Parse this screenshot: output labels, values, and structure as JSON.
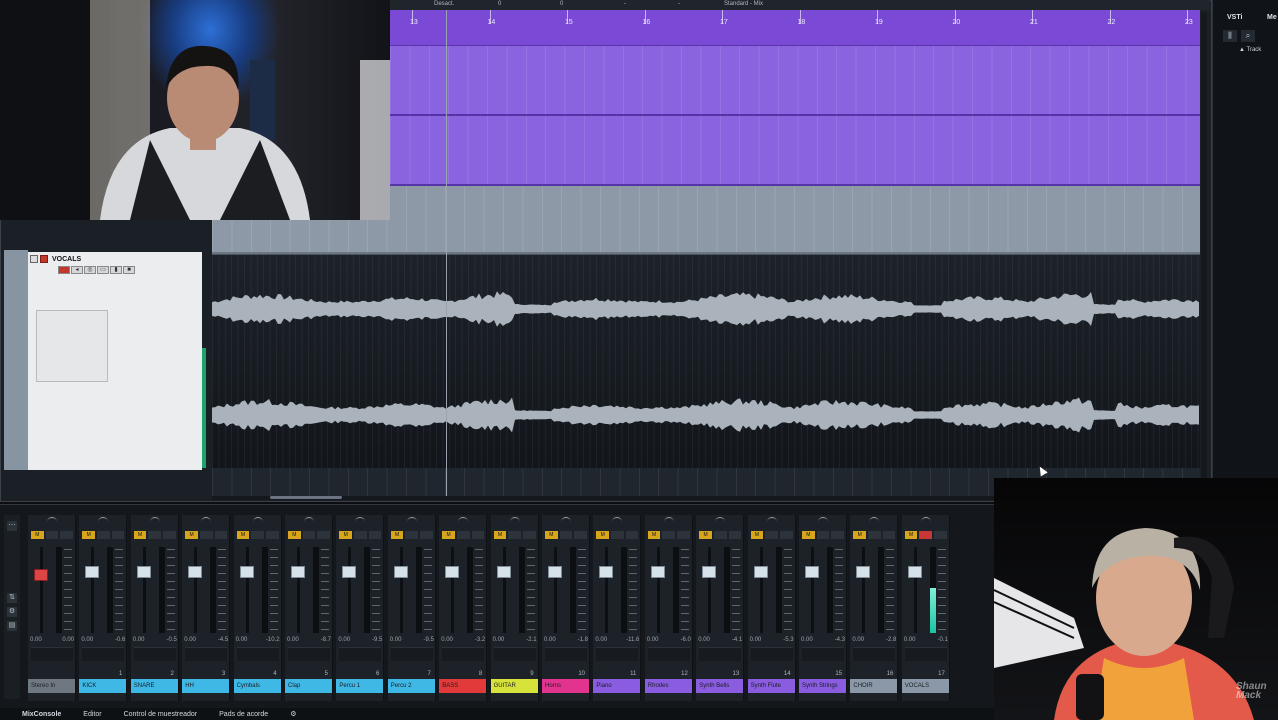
{
  "transport": {
    "labels": [
      "Desact.",
      "0",
      "0",
      "-",
      "-",
      "Standard - Mix"
    ]
  },
  "ruler": {
    "bars": [
      "13",
      "14",
      "15",
      "16",
      "17",
      "18",
      "19",
      "20",
      "21",
      "22",
      "23"
    ]
  },
  "inspector": {
    "track_name": "VOCALS"
  },
  "right_zone": {
    "tabs": [
      "VSTi",
      "Me"
    ],
    "track_label": "▲ Track"
  },
  "mixer": {
    "channels": [
      {
        "label": "Stereo In",
        "color": "#6f7780",
        "num": "",
        "values": [
          "0.00",
          "0.00"
        ],
        "meter": 0.0,
        "fader": 0.25,
        "red": true
      },
      {
        "label": "KICK",
        "color": "#3fb8e6",
        "num": "1",
        "values": [
          "0.00",
          "-0.6"
        ],
        "meter": 0.0,
        "fader": 0.22
      },
      {
        "label": "SNARE",
        "color": "#3fb8e6",
        "num": "2",
        "values": [
          "0.00",
          "-0.5"
        ],
        "meter": 0.0,
        "fader": 0.22
      },
      {
        "label": "HH",
        "color": "#3fb8e6",
        "num": "3",
        "values": [
          "0.00",
          "-4.5"
        ],
        "meter": 0.0,
        "fader": 0.22
      },
      {
        "label": "Cymbals",
        "color": "#3fb8e6",
        "num": "4",
        "values": [
          "0.00",
          "-10.2"
        ],
        "meter": 0.0,
        "fader": 0.22
      },
      {
        "label": "Clap",
        "color": "#3fb8e6",
        "num": "5",
        "values": [
          "0.00",
          "-8.7"
        ],
        "meter": 0.0,
        "fader": 0.22
      },
      {
        "label": "Percu 1",
        "color": "#3fb8e6",
        "num": "6",
        "values": [
          "0.00",
          "-9.5"
        ],
        "meter": 0.0,
        "fader": 0.22
      },
      {
        "label": "Percu 2",
        "color": "#3fb8e6",
        "num": "7",
        "values": [
          "0.00",
          "-9.5"
        ],
        "meter": 0.0,
        "fader": 0.22
      },
      {
        "label": "BASS",
        "color": "#e23a3a",
        "num": "8",
        "values": [
          "0.00",
          "-3.2"
        ],
        "meter": 0.0,
        "fader": 0.22
      },
      {
        "label": "GUITAR",
        "color": "#d7e33b",
        "num": "9",
        "values": [
          "0.00",
          "-2.1"
        ],
        "meter": 0.0,
        "fader": 0.22
      },
      {
        "label": "Horns",
        "color": "#e2348e",
        "num": "10",
        "values": [
          "0.00",
          "-1.8"
        ],
        "meter": 0.0,
        "fader": 0.22
      },
      {
        "label": "Piano",
        "color": "#8a5ce0",
        "num": "11",
        "values": [
          "0.00",
          "-11.6"
        ],
        "meter": 0.0,
        "fader": 0.22
      },
      {
        "label": "Rhodes",
        "color": "#8a5ce0",
        "num": "12",
        "values": [
          "0.00",
          "-6.0"
        ],
        "meter": 0.0,
        "fader": 0.22
      },
      {
        "label": "Synth Bells",
        "color": "#8a5ce0",
        "num": "13",
        "values": [
          "0.00",
          "-4.1"
        ],
        "meter": 0.0,
        "fader": 0.22
      },
      {
        "label": "Synth Flute",
        "color": "#8a5ce0",
        "num": "14",
        "values": [
          "0.00",
          "-5.3"
        ],
        "meter": 0.0,
        "fader": 0.22
      },
      {
        "label": "Synth Strings",
        "color": "#8a5ce0",
        "num": "15",
        "values": [
          "0.00",
          "-4.3"
        ],
        "meter": 0.0,
        "fader": 0.22
      },
      {
        "label": "CHOIR",
        "color": "#8a98a8",
        "num": "16",
        "values": [
          "0.00",
          "-2.8"
        ],
        "meter": 0.0,
        "fader": 0.22
      },
      {
        "label": "VOCALS",
        "color": "#8a98a8",
        "num": "17",
        "values": [
          "0.00",
          "-0.1"
        ],
        "meter": 0.52,
        "fader": 0.22,
        "rec": true
      }
    ]
  },
  "bottom_tabs": [
    "MixConsole",
    "Editor",
    "Control de muestreador",
    "Pads de acorde",
    "⚙"
  ],
  "watermark": "Shaun\nMack"
}
